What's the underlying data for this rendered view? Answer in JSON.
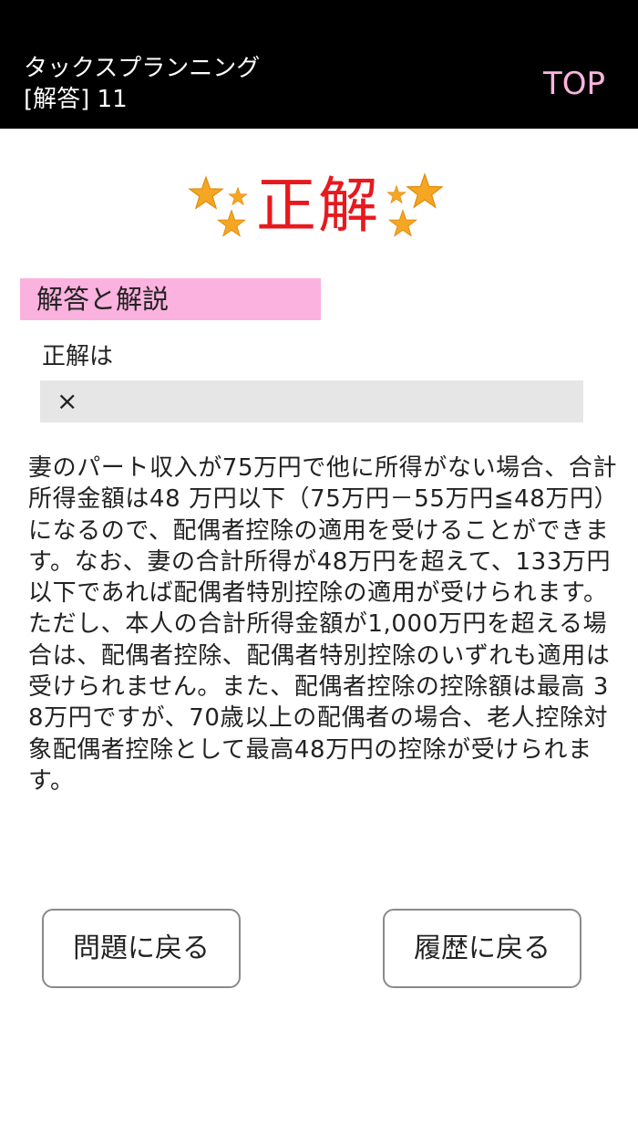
{
  "header": {
    "title_line1": "タックスプランニング",
    "title_line2": "[解答] 11",
    "top_link_label": "TOP",
    "colors": {
      "background": "#000000",
      "top_link": "#ffb3e0"
    }
  },
  "result_badge": {
    "text": "正解",
    "text_color": "#e8191e",
    "star_color": "#f5a623",
    "icon": "stars-icon"
  },
  "section": {
    "heading": "解答と解説",
    "heading_bg": "#fbb2de"
  },
  "answer": {
    "label": "正解は",
    "value": "×"
  },
  "explanation": {
    "text": "妻のパート収入が75万円で他に所得がない場合、合計所得金額は48 万円以下（75万円－55万円≦48万円）になるので、配偶者控除の適用を受けることができます。なお、妻の合計所得が48万円を超えて、133万円以下であれば配偶者特別控除の適用が受けられます。ただし、本人の合計所得金額が1,000万円を超える場合は、配偶者控除、配偶者特別控除のいずれも適用は受けられません。また、配偶者控除の控除額は最高 38万円ですが、70歳以上の配偶者の場合、老人控除対象配偶者控除として最高48万円の控除が受けられます。"
  },
  "buttons": {
    "back_to_question": "問題に戻る",
    "back_to_history": "履歴に戻る"
  }
}
